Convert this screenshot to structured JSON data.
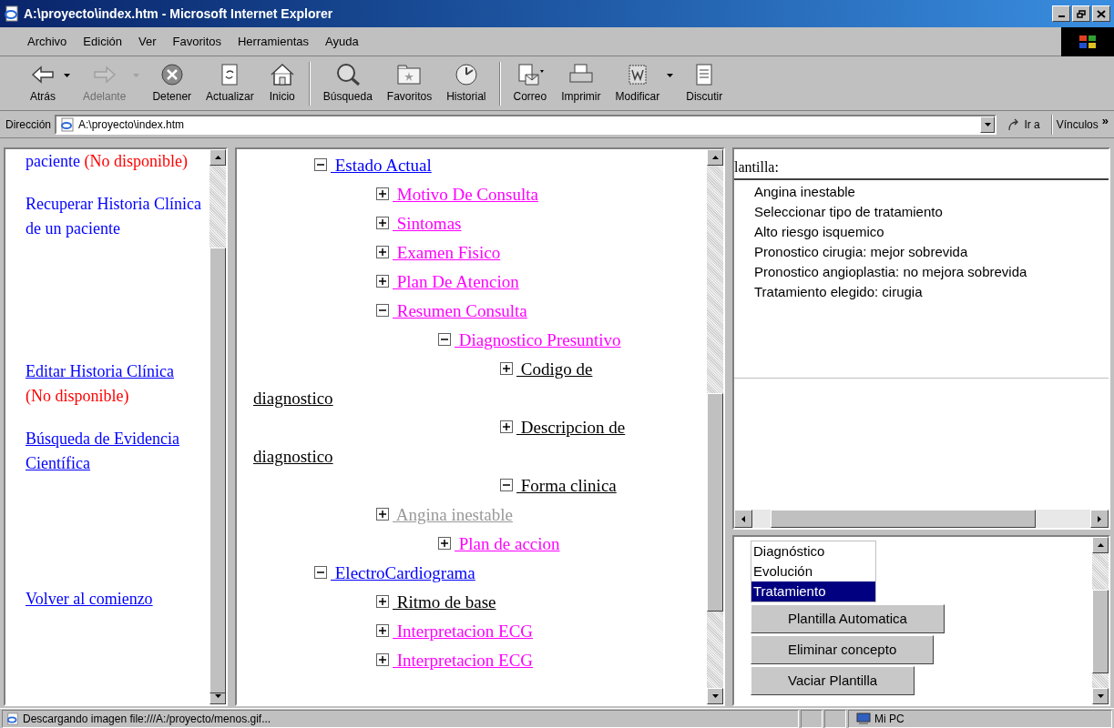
{
  "window": {
    "title": "A:\\proyecto\\index.htm - Microsoft Internet Explorer"
  },
  "menu": [
    "Archivo",
    "Edición",
    "Ver",
    "Favoritos",
    "Herramientas",
    "Ayuda"
  ],
  "toolbar": [
    {
      "label": "Atrás",
      "kind": "back",
      "disabled": false,
      "dropdown": true
    },
    {
      "label": "Adelante",
      "kind": "forward",
      "disabled": true,
      "dropdown": true
    },
    {
      "label": "Detener",
      "kind": "stop",
      "disabled": false,
      "dropdown": false
    },
    {
      "label": "Actualizar",
      "kind": "refresh",
      "disabled": false,
      "dropdown": false
    },
    {
      "label": "Inicio",
      "kind": "home",
      "disabled": false,
      "dropdown": false,
      "separator_after": true
    },
    {
      "label": "Búsqueda",
      "kind": "search",
      "disabled": false,
      "dropdown": false
    },
    {
      "label": "Favoritos",
      "kind": "favorites",
      "disabled": false,
      "dropdown": false
    },
    {
      "label": "Historial",
      "kind": "history",
      "disabled": false,
      "dropdown": false,
      "separator_after": true
    },
    {
      "label": "Correo",
      "kind": "mail",
      "disabled": false,
      "dropdown": false
    },
    {
      "label": "Imprimir",
      "kind": "print",
      "disabled": false,
      "dropdown": false
    },
    {
      "label": "Modificar",
      "kind": "edit",
      "disabled": false,
      "dropdown": true
    },
    {
      "label": "Discutir",
      "kind": "discuss",
      "disabled": false,
      "dropdown": false
    }
  ],
  "address_bar": {
    "label": "Dirección",
    "value": "A:\\proyecto\\index.htm",
    "go": "Ir a",
    "links": "Vínculos",
    "more": "»"
  },
  "left_frame": [
    {
      "text": "paciente",
      "note": "(No disponible)",
      "underlined": false
    },
    {
      "text": "Recuperar Historia Clínica de un paciente",
      "underlined": false
    },
    {
      "text": "Editar Historia Clínica",
      "note": "(No disponible)",
      "underlined": true
    },
    {
      "text": "Búsqueda de Evidencia Científica",
      "underlined": true
    },
    {
      "text": "Volver al comienzo",
      "underlined": true
    }
  ],
  "tree": [
    {
      "label": "Estado Actual",
      "color": "#0000ff",
      "expanded": true,
      "children": [
        {
          "label": "Motivo De Consulta",
          "color": "#ff00ff",
          "expanded": false
        },
        {
          "label": "Sintomas",
          "color": "#ff00ff",
          "expanded": false
        },
        {
          "label": "Examen Fisico",
          "color": "#ff00ff",
          "expanded": false
        },
        {
          "label": "Plan De Atencion",
          "color": "#ff00ff",
          "expanded": false
        },
        {
          "label": "Resumen Consulta",
          "color": "#ff00ff",
          "expanded": true,
          "children": [
            {
              "label": "Diagnostico Presuntivo",
              "color": "#ff00ff",
              "expanded": true,
              "children": [
                {
                  "label": "Codigo de diagnostico",
                  "color": "#000000",
                  "expanded": false
                },
                {
                  "label": "Descripcion de diagnostico",
                  "color": "#000000",
                  "expanded": false
                },
                {
                  "label": "Forma clinica",
                  "color": "#000000",
                  "expanded": true
                }
              ]
            }
          ]
        },
        {
          "label": "Angina inestable",
          "color": "#999999",
          "expanded": false,
          "children": [
            {
              "label": "Plan de accion",
              "color": "#ff00ff",
              "expanded": false
            }
          ]
        }
      ]
    },
    {
      "label": "ElectroCardiograma",
      "color": "#0000ff",
      "expanded": true,
      "children": [
        {
          "label": "Ritmo de base",
          "color": "#000000",
          "expanded": false
        },
        {
          "label": "Interpretacion ECG",
          "color": "#ff00ff",
          "expanded": false
        },
        {
          "label": "Interpretacion ECG",
          "color": "#ff00ff",
          "expanded": false
        }
      ]
    }
  ],
  "template": {
    "label": "lantilla:",
    "items": [
      "Angina inestable",
      "Seleccionar tipo de tratamiento",
      "Alto riesgo isquemico",
      "Pronostico cirugia: mejor sobrevida",
      "Pronostico angioplastia: no mejora sobrevida",
      "Tratamiento elegido: cirugia"
    ]
  },
  "categories": [
    {
      "label": "Diagnóstico",
      "selected": false
    },
    {
      "label": "Evolución",
      "selected": false
    },
    {
      "label": "Tratamiento",
      "selected": true
    }
  ],
  "buttons": [
    "Plantilla Automatica",
    "Eliminar concepto",
    "Vaciar Plantilla"
  ],
  "status_bar": {
    "text": "Descargando imagen file:///A:/proyecto/menos.gif...",
    "zone": "Mi PC"
  }
}
